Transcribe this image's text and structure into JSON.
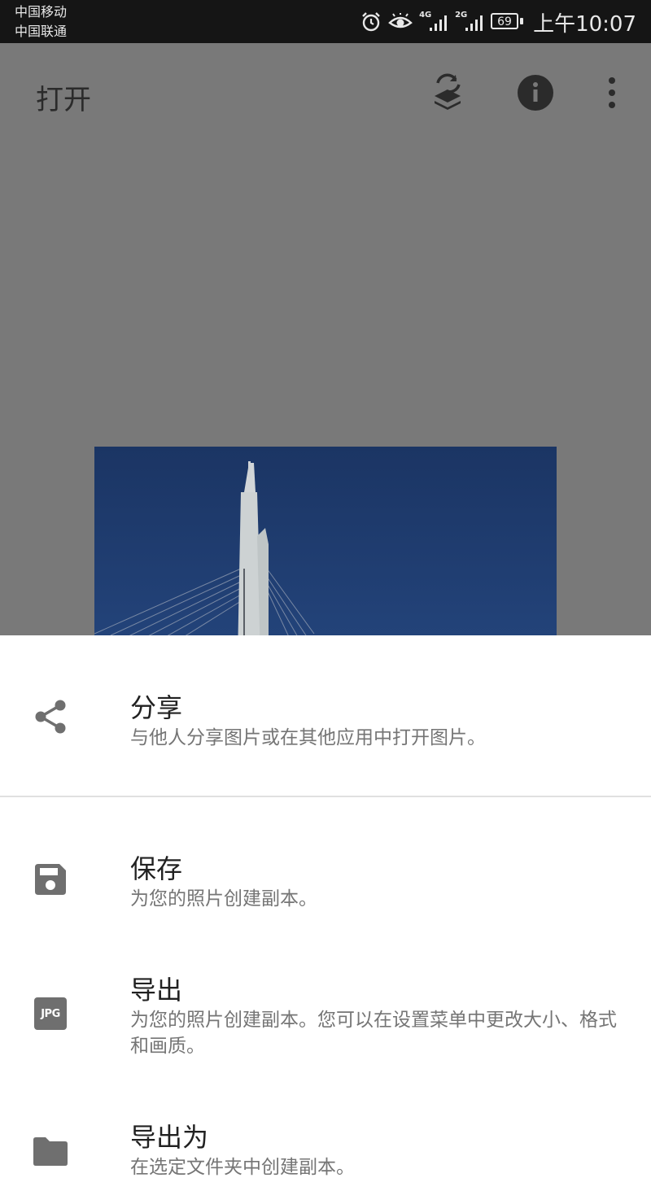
{
  "status_bar": {
    "carrier_1": "中国移动",
    "carrier_2": "中国联通",
    "net_1": "4G",
    "net_2": "2G",
    "battery": "69",
    "time": "上午10:07"
  },
  "toolbar": {
    "title": "打开",
    "icons": [
      "layers-refresh-icon",
      "info-icon",
      "more-vert-icon"
    ]
  },
  "sheet": {
    "items": [
      {
        "icon": "share-icon",
        "title": "分享",
        "description": "与他人分享图片或在其他应用中打开图片。"
      },
      {
        "icon": "save-icon",
        "title": "保存",
        "description": "为您的照片创建副本。"
      },
      {
        "icon": "jpg-icon",
        "icon_text": "JPG",
        "title": "导出",
        "description": "为您的照片创建副本。您可以在设置菜单中更改大小、格式和画质。"
      },
      {
        "icon": "folder-icon",
        "title": "导出为",
        "description": "在选定文件夹中创建副本。"
      }
    ]
  },
  "colors": {
    "scrim": "#797979",
    "icon_gray": "#6f6f6f",
    "photo_sky": "#1f3b6e"
  }
}
